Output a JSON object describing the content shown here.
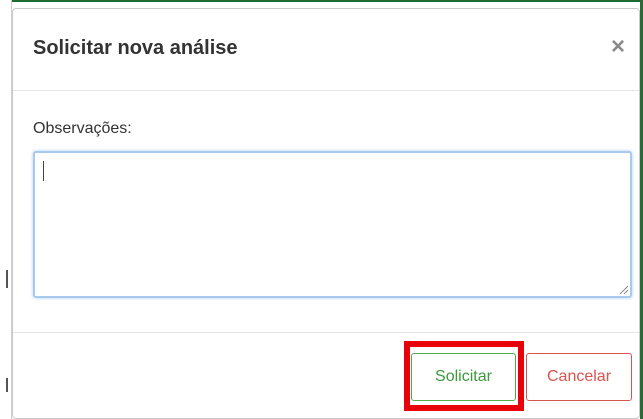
{
  "modal": {
    "title": "Solicitar nova análise",
    "close_label": "×"
  },
  "form": {
    "observacoes_label": "Observações:",
    "observacoes_value": ""
  },
  "footer": {
    "submit_label": "Solicitar",
    "cancel_label": "Cancelar"
  },
  "colors": {
    "submit_accent": "#4cae4c",
    "cancel_accent": "#d9534f",
    "highlight": "#e8000b",
    "focus_border": "#a9c9ee"
  }
}
